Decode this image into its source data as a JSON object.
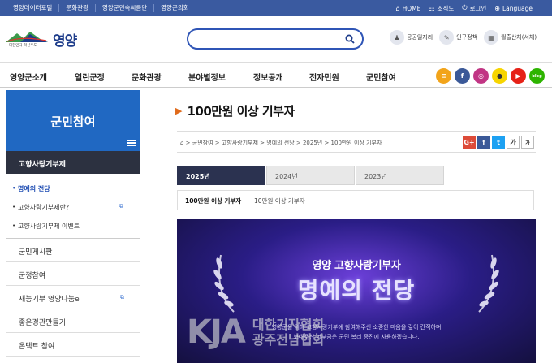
{
  "topbar": {
    "links": [
      "영양데이터포털",
      "문화관광",
      "영양군민속씨름단",
      "영양군의회"
    ],
    "home": "HOME",
    "sitemap": "조직도",
    "login": "로그인",
    "language": "Language"
  },
  "header": {
    "logo_name": "영양",
    "logo_tagline": "대한민국 혁신주도",
    "search_placeholder": "",
    "quick_links": [
      "공공일자리",
      "인구정책",
      "월출산체(서체)"
    ]
  },
  "gnb": {
    "items": [
      "영양군소개",
      "열린군정",
      "문화관광",
      "분야별정보",
      "정보공개",
      "전자민원",
      "군민참여"
    ],
    "sns": [
      "≡",
      "f",
      "◎",
      "●",
      "▶",
      "blog"
    ]
  },
  "sidebar": {
    "title": "군민참여",
    "section": "고향사랑기부제",
    "sub_items": [
      {
        "label": "명예의 전당"
      },
      {
        "label": "고향사랑기부제란?"
      },
      {
        "label": "고향사랑기부제 이벤트"
      }
    ],
    "menu": [
      "군민게시판",
      "군정참여",
      "재능기부 영양나눔e",
      "좋은경관만들기",
      "온택트 참여"
    ]
  },
  "content": {
    "title": "100만원 이상 기부자",
    "breadcrumb": "⌂  >  군민참여  >  고향사랑기부제  >  명예의 전당  >  2025년  >  100만원 이상 기부자",
    "share": [
      "G+",
      "f",
      "t",
      "가",
      "가"
    ],
    "year_tabs": [
      "2025년",
      "2024년",
      "2023년"
    ],
    "sub_tabs": [
      "100만원 이상 기부자",
      "10만원 이상 기부자"
    ],
    "banner": {
      "subtitle": "영양 고향사랑기부자",
      "title": "명예의 전당",
      "desc1": "영양군을 위해 고향사랑기부에 참여해주신 소중한 마음을 깊이 간직하며",
      "desc2": "보내주신 기부금은 군민 복리 증진에 사용하겠습니다."
    },
    "watermark": {
      "logo": "KJA",
      "line1": "대한기자협회",
      "line2": "광주전남협회"
    }
  },
  "colors": {
    "topbar": "#3a5aa0",
    "accent": "#2068c2",
    "tab_active": "#2b3250"
  }
}
